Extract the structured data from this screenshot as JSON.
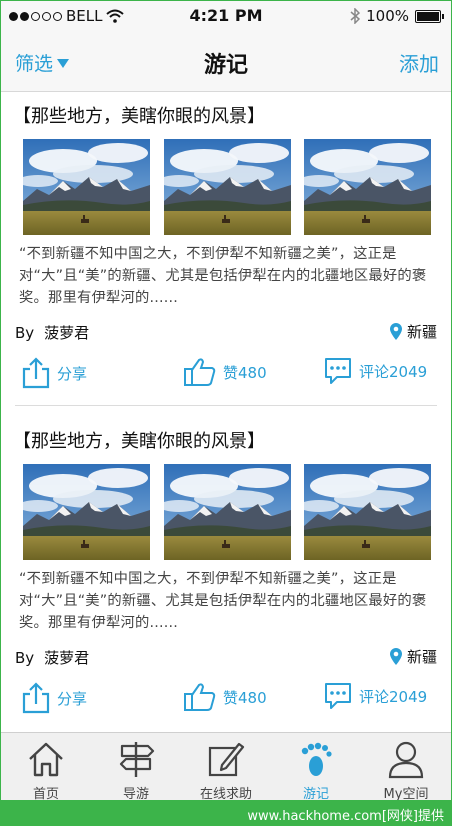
{
  "status_bar": {
    "carrier": "BELL",
    "time": "4:21 PM",
    "battery_label": "100%"
  },
  "nav": {
    "filter_label": "筛选",
    "title": "游记",
    "add_label": "添加"
  },
  "posts": [
    {
      "title": "【那些地方，美瞎你眼的风景】",
      "excerpt": "“不到新疆不知中国之大，不到伊犁不知新疆之美”，这正是对“大”且“美”的新疆、尤其是包括伊犁在内的北疆地区最好的褒奖。那里有伊犁河的......",
      "by_label": "By",
      "author": "菠萝君",
      "location": "新疆",
      "share_label": "分享",
      "like_label": "赞480",
      "comment_label": "评论2049"
    },
    {
      "title": "【那些地方，美瞎你眼的风景】",
      "excerpt": "“不到新疆不知中国之大，不到伊犁不知新疆之美”，这正是对“大”且“美”的新疆、尤其是包括伊犁在内的北疆地区最好的褒奖。那里有伊犁河的......",
      "by_label": "By",
      "author": "菠萝君",
      "location": "新疆",
      "share_label": "分享",
      "like_label": "赞480",
      "comment_label": "评论2049"
    }
  ],
  "tabs": [
    {
      "label": "首页",
      "icon": "home-icon"
    },
    {
      "label": "导游",
      "icon": "signpost-icon"
    },
    {
      "label": "在线求助",
      "icon": "edit-icon"
    },
    {
      "label": "游记",
      "icon": "footprint-icon",
      "active": true
    },
    {
      "label": "My空间",
      "icon": "user-icon"
    }
  ],
  "watermark": "www.hackhome.com[网侠]提供",
  "colors": {
    "accent": "#2a9fd6",
    "watermark_green": "#3cb44a"
  }
}
